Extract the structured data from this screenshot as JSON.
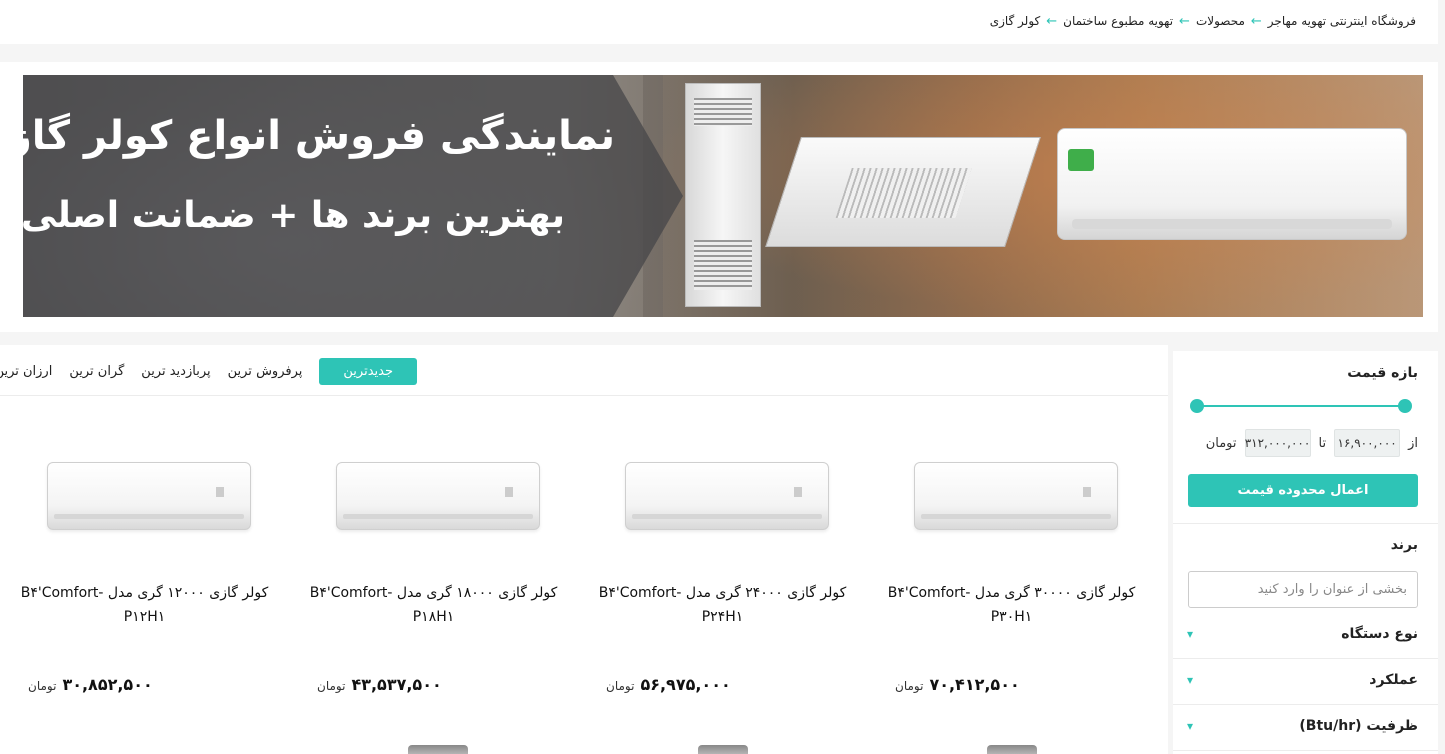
{
  "breadcrumb": {
    "items": [
      "فروشگاه اینترنتی تهویه مهاجر",
      "محصولات",
      "تهویه مطبوع ساختمان",
      "کولر گازی"
    ]
  },
  "banner": {
    "title": "نمایندگی فروش انواع کولر گازی",
    "subtitle": "بهترین برند ها + ضمانت اصلی"
  },
  "sort": {
    "items": [
      "جدیدترین",
      "پرفروش ترین",
      "پربازدید ترین",
      "گران ترین",
      "ارزان ترین"
    ],
    "active_index": 0
  },
  "filters": {
    "price": {
      "title": "بازه قیمت",
      "from_label": "از",
      "from_value": "۱۶,۹۰۰,۰۰۰",
      "to_label": "تا",
      "to_value": "۳۱۲,۰۰۰,۰۰۰",
      "currency": "تومان",
      "apply_label": "اعمال محدوده قیمت"
    },
    "brand": {
      "title": "برند",
      "search_placeholder": "بخشی از عنوان را وارد کنید"
    },
    "accordions": [
      "نوع دستگاه",
      "عملکرد",
      "ظرفیت (Btu/hr)"
    ]
  },
  "products": [
    {
      "name": "کولر گازی ۳۰۰۰۰ گری مدل B۴'Comfort- P۳۰H۱",
      "price": "۷۰,۴۱۲,۵۰۰",
      "currency": "تومان"
    },
    {
      "name": "کولر گازی ۲۴۰۰۰ گری مدل B۴'Comfort- P۲۴H۱",
      "price": "۵۶,۹۷۵,۰۰۰",
      "currency": "تومان"
    },
    {
      "name": "کولر گازی ۱۸۰۰۰ گری مدل B۴'Comfort- P۱۸H۱",
      "price": "۴۳,۵۳۷,۵۰۰",
      "currency": "تومان"
    },
    {
      "name": "کولر گازی ۱۲۰۰۰ گری مدل B۴'Comfort- P۱۲H۱",
      "price": "۳۰,۸۵۲,۵۰۰",
      "currency": "تومان"
    }
  ],
  "colors": {
    "accent": "#2ec4b6",
    "page_bg": "#f5f5f5"
  }
}
